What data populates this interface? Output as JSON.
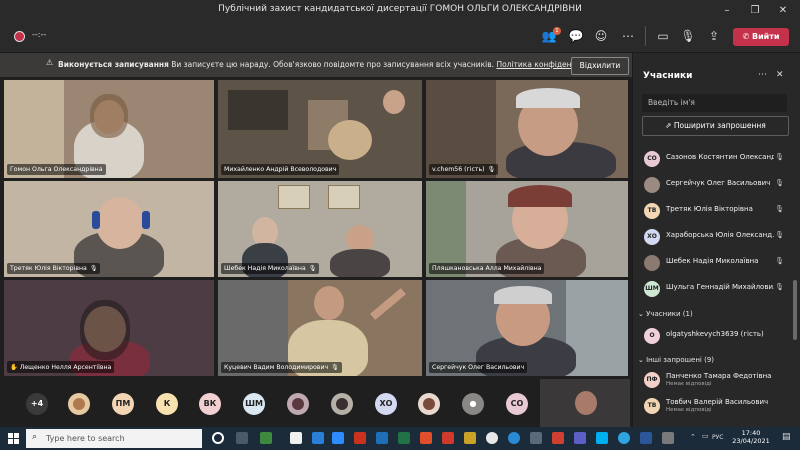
{
  "window": {
    "title": "Публічний захист кандидатської дисертації ГОМОН ОЛЬГИ ОЛЕКСАНДРІВНИ"
  },
  "toolbar": {
    "timer": "--:--",
    "participants_badge": "1",
    "leave_label": "Вийти"
  },
  "banner": {
    "title": "Виконується записування",
    "text": "Ви записуєте цю нараду. Обов'язково повідомте про записування всіх учасників.",
    "link": "Політика конфіденційності",
    "dismiss": "Відхилити"
  },
  "tiles": [
    {
      "name": "Гомон Ольга Олександрівна",
      "bg": "#8a7a6a"
    },
    {
      "name": "Михайленко Андрій Всеволодович",
      "bg": "#6b5d4f"
    },
    {
      "name": "v.chem56 (гість)",
      "bg": "#7b6a5a"
    },
    {
      "name": "Третяк Юлія Вікторівна",
      "bg": "#b9aa99"
    },
    {
      "name": "Шебек Надія Миколаївна",
      "bg": "#aaa59a"
    },
    {
      "name": "Пляшкановська Алла Михайлівна",
      "bg": "#b6b0a3"
    },
    {
      "name": "Лещенко Нелля Арсентіївна",
      "bg": "#4f3d44"
    },
    {
      "name": "Куцевич Вадим Володимирович",
      "bg": "#8a7560"
    },
    {
      "name": "Сергейчук Олег Васильович",
      "bg": "#6f7478"
    }
  ],
  "strip": {
    "more": "+4",
    "avatars": [
      "ПМ",
      "К",
      "ВК",
      "ШМ",
      "ХО",
      "СО"
    ]
  },
  "panel": {
    "title": "Учасники",
    "search_placeholder": "Введіть ім'я",
    "share": "Поширити запрошення",
    "people": [
      {
        "initials": "СО",
        "name": "Сазонов Костянтин Олександ...",
        "color": "#e8c9d4"
      },
      {
        "initials": "",
        "name": "Сергейчук Олег Васильович",
        "color": "#c8c8c8"
      },
      {
        "initials": "ТВ",
        "name": "Третяк Юлія Вікторівна",
        "color": "#f2d6b3"
      },
      {
        "initials": "ХО",
        "name": "Хараборська Юлія Олександ...",
        "color": "#d4d9f2"
      },
      {
        "initials": "",
        "name": "Шебек Надія Миколаївна",
        "color": "#c8c8c8"
      },
      {
        "initials": "ШМ",
        "name": "Шульга Геннадій Михайлови...",
        "color": "#cfe8d4"
      }
    ],
    "section_attendees": "Учасники (1)",
    "guest": {
      "initials": "O",
      "name": "olgatyshkevych3639 (гість)",
      "color": "#f0d0dc"
    },
    "section_invited": "Інші запрошені (9)",
    "invited": [
      {
        "initials": "ПФ",
        "name": "Панченко Тамара Федотівна",
        "sub": "Немає відповіді",
        "color": "#f2d0c6"
      },
      {
        "initials": "ТВ",
        "name": "Товбич Валерій Васильович",
        "sub": "Немає відповіді",
        "color": "#f2d6b3"
      }
    ]
  },
  "taskbar": {
    "search_placeholder": "Type here to search",
    "time": "17:40",
    "date": "23/04/2021",
    "lang": "РУС"
  }
}
